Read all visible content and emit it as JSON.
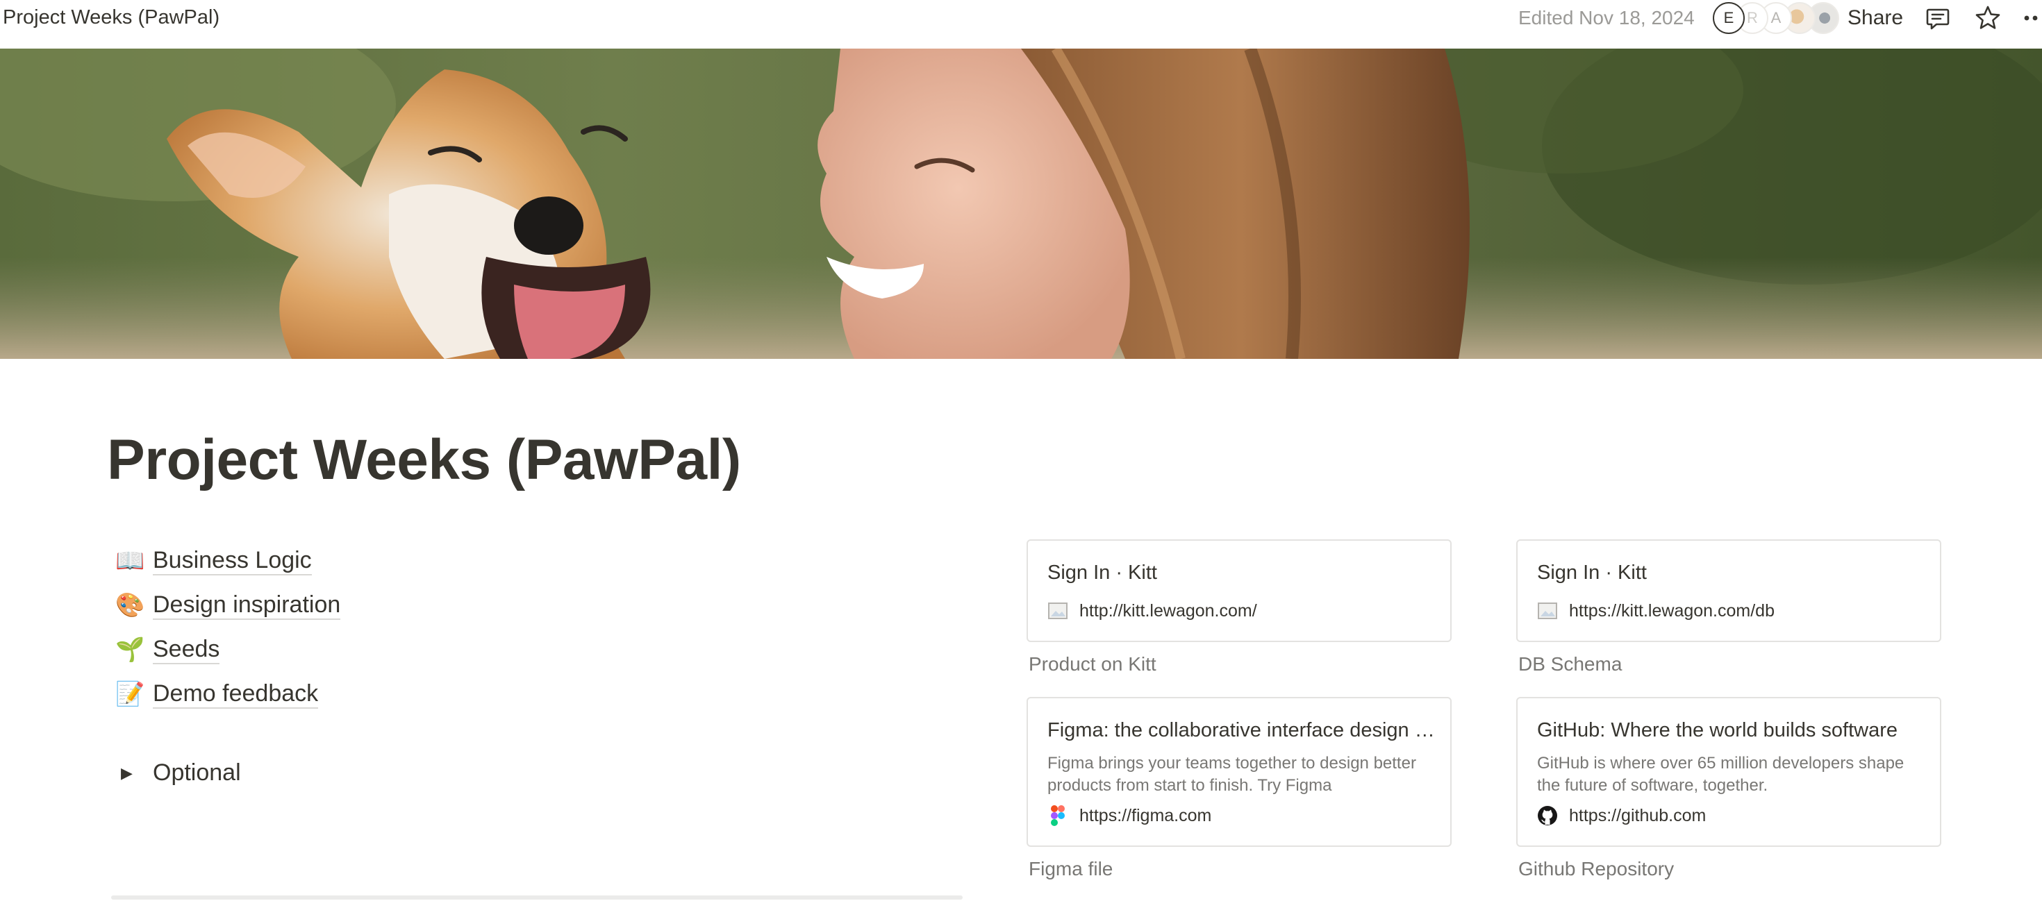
{
  "topbar": {
    "breadcrumb": "Project Weeks (PawPal)",
    "edited": "Edited Nov 18, 2024",
    "avatars": [
      "E",
      "R",
      "A"
    ],
    "share_label": "Share"
  },
  "page": {
    "title": "Project Weeks (PawPal)",
    "links": [
      {
        "emoji": "📖",
        "label": "Business Logic"
      },
      {
        "emoji": "🎨",
        "label": "Design inspiration"
      },
      {
        "emoji": "🌱",
        "label": "Seeds"
      },
      {
        "emoji": "📝",
        "label": "Demo feedback"
      }
    ],
    "toggle": {
      "label": "Optional"
    }
  },
  "bookmarks": [
    {
      "title": "Sign In · Kitt",
      "description": "",
      "url": "http://kitt.lewagon.com/",
      "caption": "Product on Kitt",
      "favicon": "image-placeholder-icon"
    },
    {
      "title": "Sign In · Kitt",
      "description": "",
      "url": "https://kitt.lewagon.com/db",
      "caption": "DB Schema",
      "favicon": "image-placeholder-icon"
    },
    {
      "title": "Figma: the collaborative interface design tool",
      "description": "Figma brings your teams together to design better products from start to finish. Try Figma",
      "url": "https://figma.com",
      "caption": "Figma file",
      "favicon": "figma-icon"
    },
    {
      "title": "GitHub: Where the world builds software",
      "description": "GitHub is where over 65 million developers shape the future of software, together.",
      "url": "https://github.com",
      "caption": "Github Repository",
      "favicon": "github-icon"
    }
  ],
  "colors": {
    "text": "#37352f",
    "muted": "#787774",
    "border": "#e3e2e0"
  }
}
